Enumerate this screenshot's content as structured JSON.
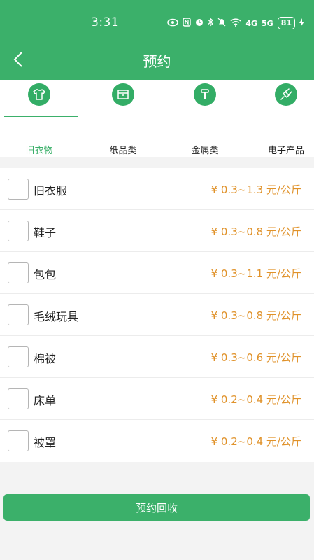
{
  "status_bar": {
    "time": "3:31",
    "battery": "81",
    "network": "4G",
    "network2": "5G"
  },
  "nav": {
    "title": "预约"
  },
  "tabs": [
    {
      "label": "旧衣物",
      "icon": "clothes-icon",
      "active": true
    },
    {
      "label": "纸品类",
      "icon": "box-icon",
      "active": false
    },
    {
      "label": "金属类",
      "icon": "screw-icon",
      "active": false
    },
    {
      "label": "电子产品",
      "icon": "plug-icon",
      "active": false
    }
  ],
  "items": [
    {
      "name": "旧衣服",
      "price": "¥ 0.3~1.3 元/公斤",
      "checked": false
    },
    {
      "name": "鞋子",
      "price": "¥ 0.3~0.8 元/公斤",
      "checked": false
    },
    {
      "name": "包包",
      "price": "¥ 0.3~1.1 元/公斤",
      "checked": false
    },
    {
      "name": "毛绒玩具",
      "price": "¥ 0.3~0.8 元/公斤",
      "checked": false
    },
    {
      "name": "棉被",
      "price": "¥ 0.3~0.6 元/公斤",
      "checked": false
    },
    {
      "name": "床单",
      "price": "¥ 0.2~0.4 元/公斤",
      "checked": false
    },
    {
      "name": "被罩",
      "price": "¥ 0.2~0.4 元/公斤",
      "checked": false
    }
  ],
  "submit": {
    "label": "预约回收"
  },
  "colors": {
    "primary": "#3bb06a",
    "price": "#e0922a",
    "background": "#f3f3f3"
  }
}
